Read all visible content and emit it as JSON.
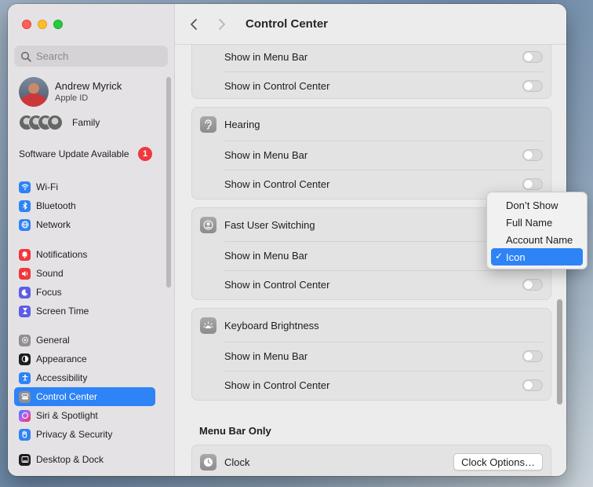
{
  "window": {
    "title": "Control Center"
  },
  "sidebar": {
    "search_placeholder": "Search",
    "profile": {
      "name": "Andrew Myrick",
      "subtitle": "Apple ID"
    },
    "family_label": "Family",
    "update": {
      "label": "Software Update Available",
      "count": "1"
    },
    "items": [
      {
        "label": "Wi-Fi",
        "icon": "wifi-icon",
        "color": "#2e83f6"
      },
      {
        "label": "Bluetooth",
        "icon": "bluetooth-icon",
        "color": "#2e83f6"
      },
      {
        "label": "Network",
        "icon": "globe-icon",
        "color": "#2e83f6"
      },
      {
        "label": "Notifications",
        "icon": "bell-icon",
        "color": "#f0373d"
      },
      {
        "label": "Sound",
        "icon": "speaker-icon",
        "color": "#f0373d"
      },
      {
        "label": "Focus",
        "icon": "moon-icon",
        "color": "#5e5ce6"
      },
      {
        "label": "Screen Time",
        "icon": "hourglass-icon",
        "color": "#5e5ce6"
      },
      {
        "label": "General",
        "icon": "gear-icon",
        "color": "#8e8e93"
      },
      {
        "label": "Appearance",
        "icon": "appearance-icon",
        "color": "#1d1d1f"
      },
      {
        "label": "Accessibility",
        "icon": "accessibility-icon",
        "color": "#2e83f6"
      },
      {
        "label": "Control Center",
        "icon": "control-center-icon",
        "color": "#8e8e93",
        "active": true
      },
      {
        "label": "Siri & Spotlight",
        "icon": "siri-icon",
        "color": "#bf5af2"
      },
      {
        "label": "Privacy & Security",
        "icon": "hand-icon",
        "color": "#2e83f6"
      },
      {
        "label": "Desktop & Dock",
        "icon": "dock-icon",
        "color": "#1d1d1f"
      }
    ]
  },
  "main": {
    "partial_card": {
      "rows": [
        "Show in Menu Bar",
        "Show in Control Center"
      ]
    },
    "hearing": {
      "title": "Hearing",
      "rows": [
        "Show in Menu Bar",
        "Show in Control Center"
      ]
    },
    "fast_user": {
      "title": "Fast User Switching",
      "rows": [
        "Show in Menu Bar",
        "Show in Control Center"
      ]
    },
    "keyboard": {
      "title": "Keyboard Brightness",
      "rows": [
        "Show in Menu Bar",
        "Show in Control Center"
      ]
    },
    "menu_bar_only": {
      "section_title": "Menu Bar Only",
      "clock_label": "Clock",
      "clock_button": "Clock Options…"
    }
  },
  "popup_menu": {
    "items": [
      "Don’t Show",
      "Full Name",
      "Account Name",
      "Icon"
    ],
    "selected": "Icon",
    "check_glyph": "✓"
  }
}
